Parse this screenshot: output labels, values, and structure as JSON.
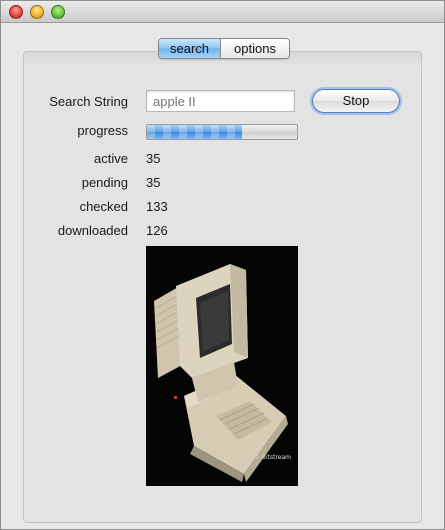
{
  "tabs": [
    {
      "label": "search",
      "active": true
    },
    {
      "label": "options",
      "active": false
    }
  ],
  "search": {
    "label": "Search String",
    "placeholder": "apple II",
    "value": ""
  },
  "stop_button": {
    "label": "Stop"
  },
  "progress": {
    "label": "progress",
    "fraction": 0.63
  },
  "stats": {
    "active": {
      "label": "active",
      "value": "35"
    },
    "pending": {
      "label": "pending",
      "value": "35"
    },
    "checked": {
      "label": "checked",
      "value": "133"
    },
    "downloaded": {
      "label": "downloaded",
      "value": "126"
    }
  },
  "photo": {
    "caption": "© Bitstream"
  },
  "colors": {
    "accent": "#6fb2ea",
    "close": "#e0443a",
    "minimize": "#f0b429",
    "maximize": "#5fc23a"
  }
}
